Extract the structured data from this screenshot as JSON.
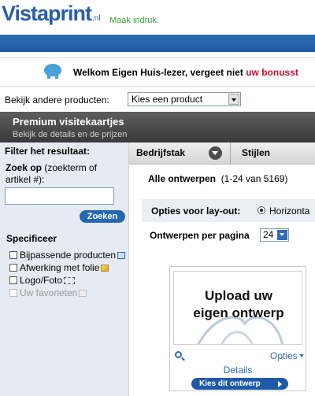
{
  "header": {
    "logo_text": "Vistaprint",
    "logo_tld": ".nl",
    "tagline": "Maak indruk."
  },
  "promo": {
    "text": "Welkom Eigen Huis-lezer, vergeet niet",
    "highlight": "uw bonusst"
  },
  "product_picker": {
    "label": "Bekijk andere producten:",
    "selected": "Kies een product"
  },
  "title_bar": {
    "title": "Premium visitekaartjes",
    "subtitle": "Bekijk de details en de prijzen"
  },
  "sidebar": {
    "filter_title": "Filter het resultaat:",
    "search_label": "Zoek op",
    "search_hint": "(zoekterm of artikel #):",
    "search_value": "",
    "search_button": "Zoeken",
    "spec_title": "Specificeer",
    "spec_items": [
      {
        "label": "Bijpassende producten",
        "icon": "matching-products-icon",
        "enabled": true
      },
      {
        "label": "Afwerking met folie",
        "icon": "foil-icon",
        "enabled": true
      },
      {
        "label": "Logo/Foto",
        "icon": "photo-frame-icon",
        "enabled": true
      },
      {
        "label": "Uw favorieten",
        "icon": "favorites-icon",
        "enabled": false
      }
    ]
  },
  "tabs": {
    "tab1": "Bedrijfstak",
    "tab2": "Stijlen"
  },
  "results": {
    "title": "Alle ontwerpen",
    "count": "(1-24 van 5169)",
    "layout_label": "Opties voor lay-out:",
    "layout_option": "Horizonta",
    "per_page_label": "Ontwerpen per pagina",
    "per_page_value": "24"
  },
  "card": {
    "upload_line1": "Upload uw",
    "upload_line2": "eigen ontwerp",
    "options_link": "Opties",
    "details_link": "Details",
    "choose_button": "Kies dit ontwerp"
  }
}
